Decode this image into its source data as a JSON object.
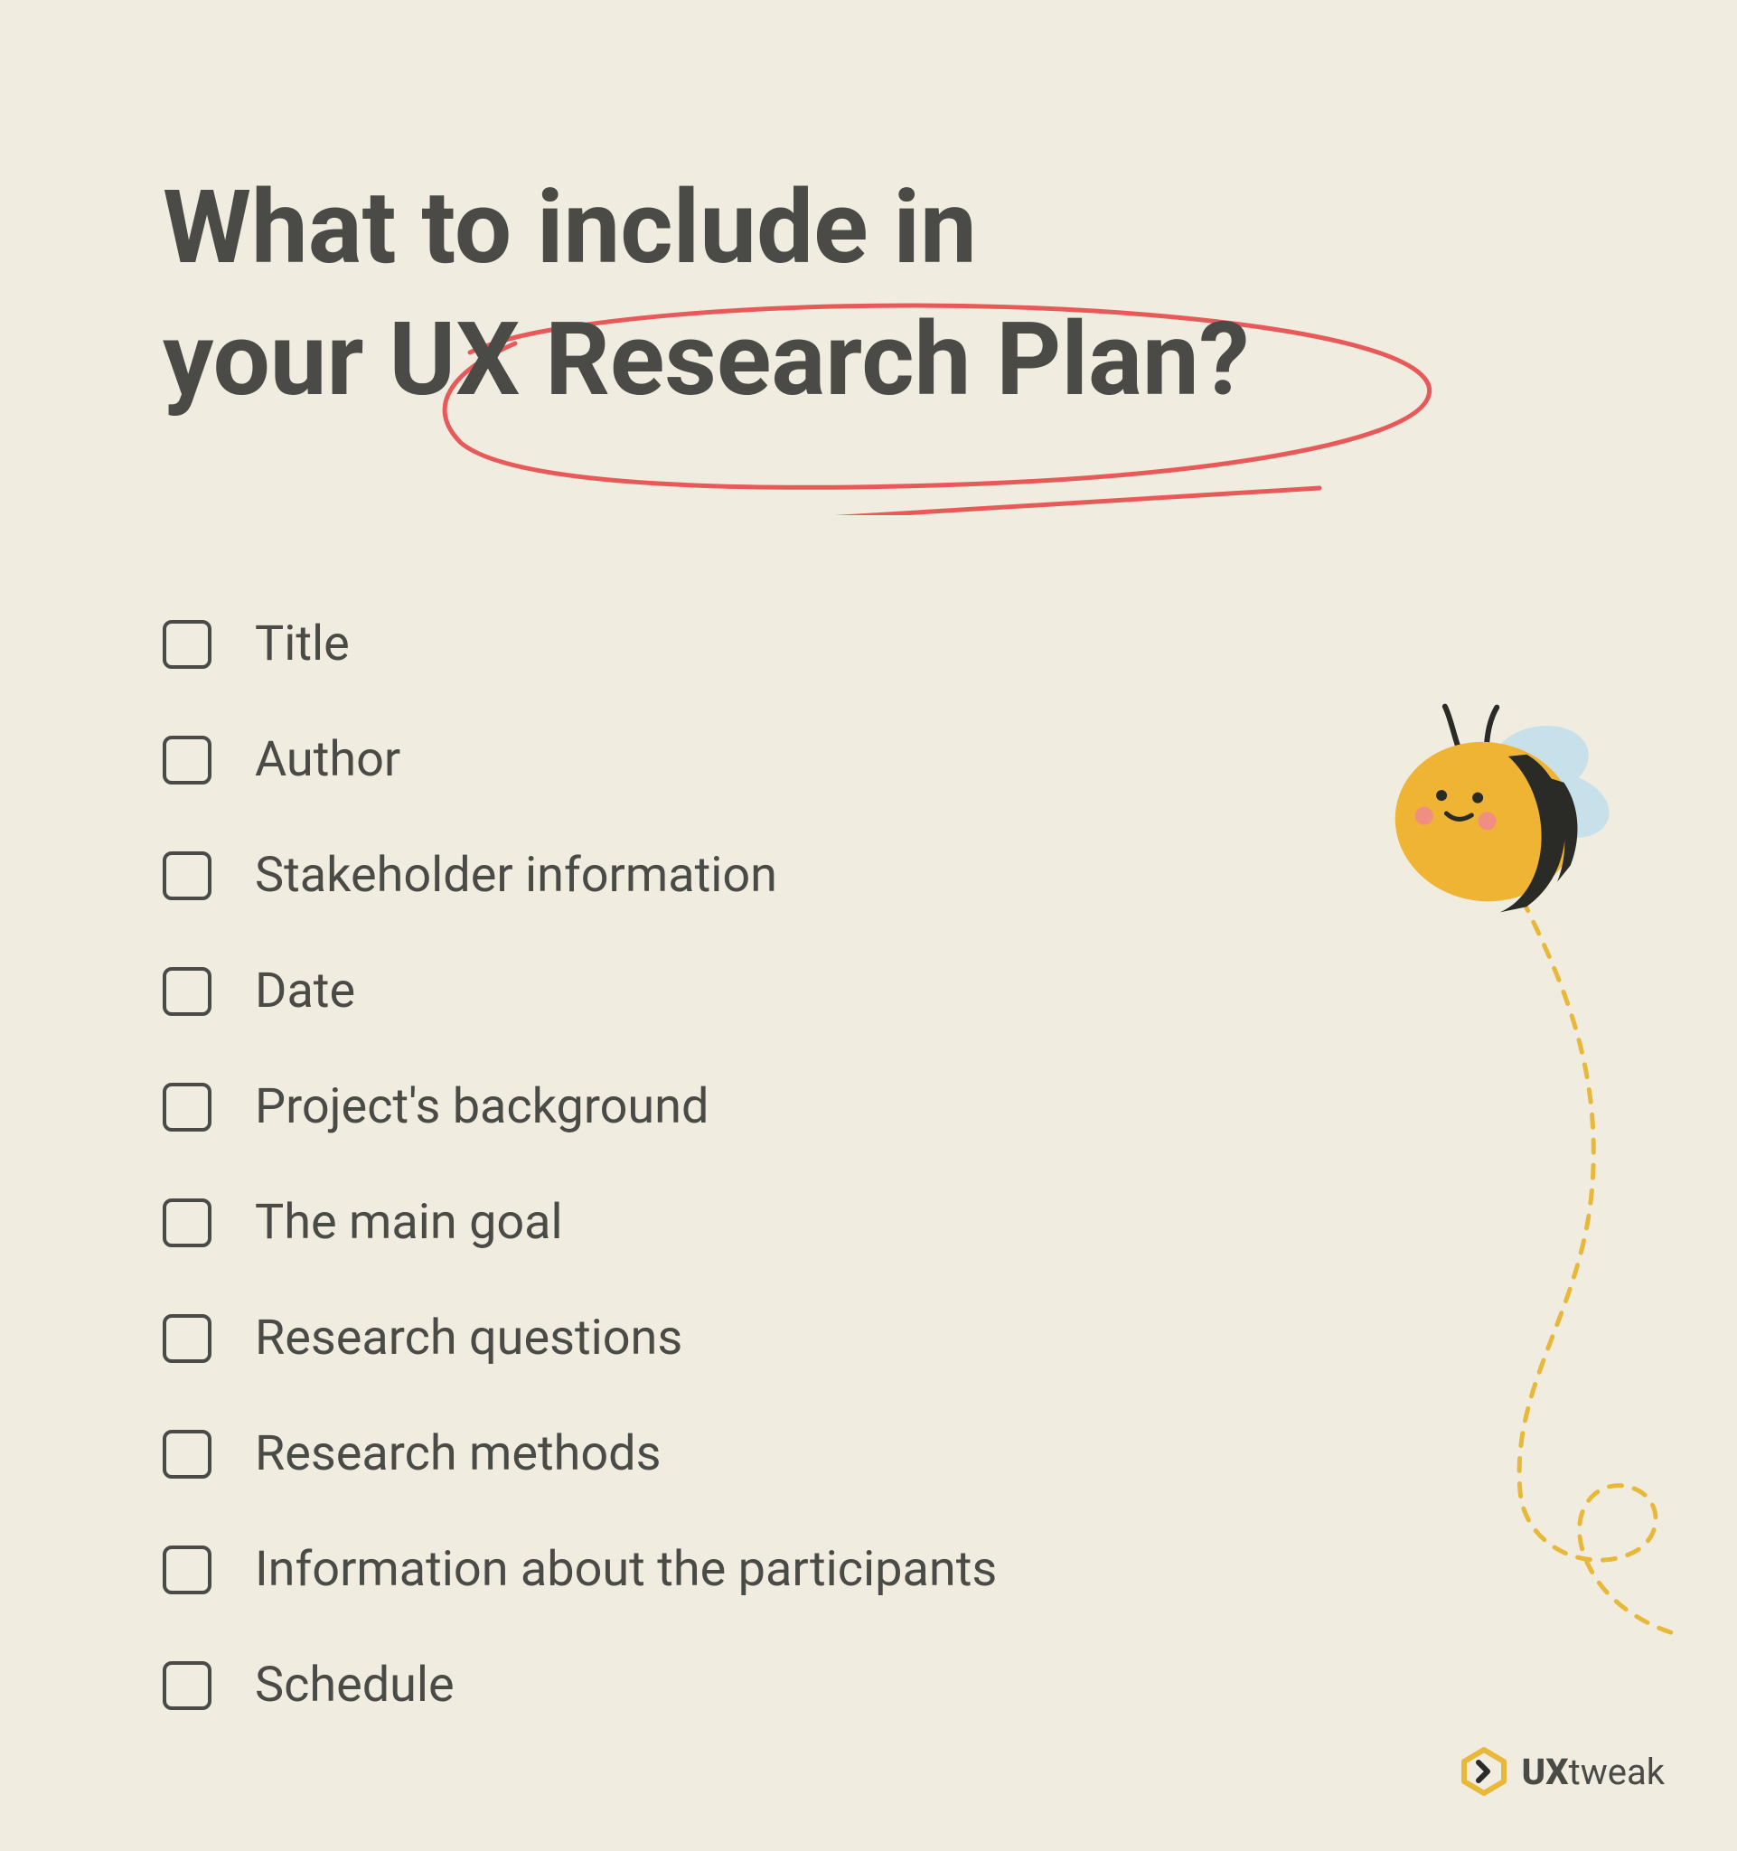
{
  "title_line1": "What to include in",
  "title_line2": "your UX Research Plan?",
  "checklist": {
    "items": [
      {
        "label": "Title"
      },
      {
        "label": "Author"
      },
      {
        "label": "Stakeholder information"
      },
      {
        "label": "Date"
      },
      {
        "label": "Project's background"
      },
      {
        "label": "The main goal"
      },
      {
        "label": "Research questions"
      },
      {
        "label": "Research methods"
      },
      {
        "label": "Information about the participants"
      },
      {
        "label": "Schedule"
      }
    ]
  },
  "brand": {
    "prefix": "UX",
    "suffix": "tweak"
  }
}
